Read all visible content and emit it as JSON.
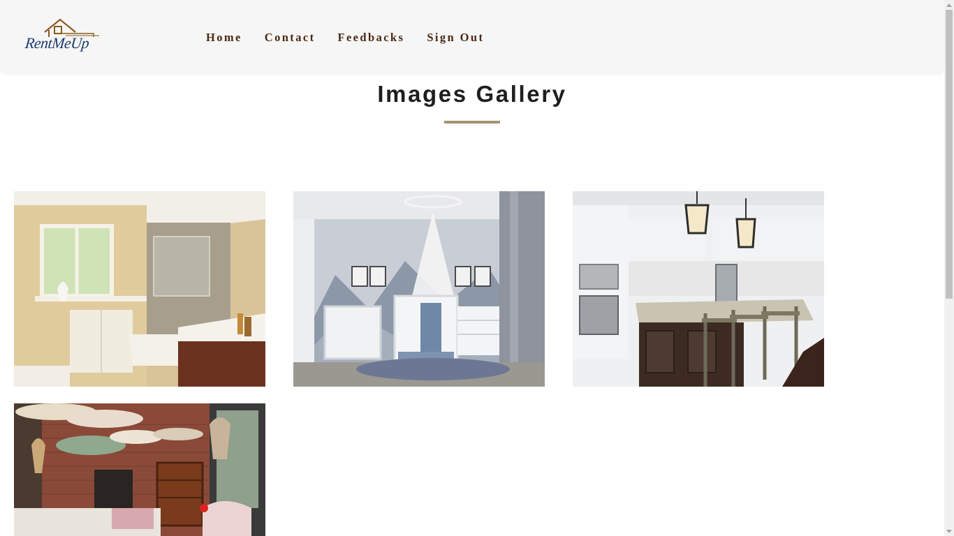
{
  "brand": {
    "name": "RentMeUp"
  },
  "nav": {
    "items": [
      {
        "label": "Home"
      },
      {
        "label": "Contact"
      },
      {
        "label": "Feedbacks"
      },
      {
        "label": "Sign Out"
      }
    ]
  },
  "gallery": {
    "title": "Images Gallery",
    "images": [
      {
        "subject": "bathroom"
      },
      {
        "subject": "nursery"
      },
      {
        "subject": "kitchen"
      },
      {
        "subject": "living-room"
      }
    ]
  },
  "colors": {
    "header_bg": "#f6f6f6",
    "nav_text": "#4a2a14",
    "title_rule": "#a89172",
    "logo_blue": "#1c3e70",
    "logo_brown": "#8a5a1e"
  }
}
